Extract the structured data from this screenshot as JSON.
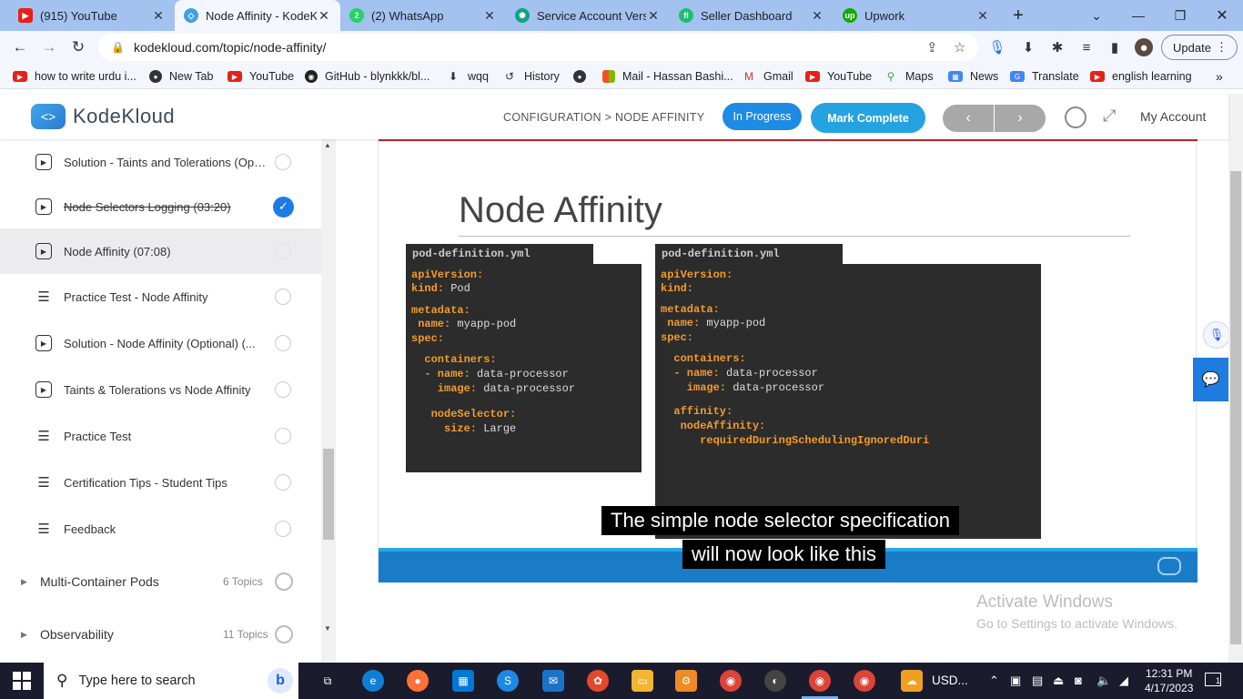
{
  "browser": {
    "tabs": [
      {
        "title": "(915) YouTube",
        "favicon": "youtube-icon"
      },
      {
        "title": "Node Affinity - KodeKloud",
        "favicon": "kodekloud-icon"
      },
      {
        "title": "(2) WhatsApp",
        "favicon": "whatsapp-icon"
      },
      {
        "title": "Service Account Version",
        "favicon": "openai-icon"
      },
      {
        "title": "Seller Dashboard",
        "favicon": "fiverr-icon"
      },
      {
        "title": "Upwork",
        "favicon": "upwork-icon"
      }
    ],
    "url": "kodekloud.com/topic/node-affinity/",
    "update_label": "Update",
    "bookmarks": [
      {
        "label": "how to write urdu i...",
        "icon": "youtube-icon"
      },
      {
        "label": "New Tab",
        "icon": "globe-icon"
      },
      {
        "label": "YouTube",
        "icon": "youtube-icon"
      },
      {
        "label": "GitHub - blynkkk/bl...",
        "icon": "github-icon"
      },
      {
        "label": "wqq",
        "icon": "download-icon"
      },
      {
        "label": "History",
        "icon": "history-icon"
      },
      {
        "label": "",
        "icon": "globe-icon"
      },
      {
        "label": "Mail - Hassan Bashi...",
        "icon": "microsoft-icon"
      },
      {
        "label": "Gmail",
        "icon": "gmail-icon"
      },
      {
        "label": "YouTube",
        "icon": "youtube-icon"
      },
      {
        "label": "Maps",
        "icon": "maps-icon"
      },
      {
        "label": "News",
        "icon": "news-icon"
      },
      {
        "label": "Translate",
        "icon": "translate-icon"
      },
      {
        "label": "english learning",
        "icon": "youtube-icon"
      }
    ]
  },
  "header": {
    "logo_text": "KodeKloud",
    "breadcrumb": "CONFIGURATION > NODE AFFINITY",
    "status_label": "In Progress",
    "mark_complete_label": "Mark Complete",
    "prev_label": "‹",
    "next_label": "›",
    "account_label": "My Account"
  },
  "sidebar": {
    "items": [
      {
        "label": "Solution - Taints and Tolerations (Optional)",
        "type": "video",
        "done": false,
        "current": false
      },
      {
        "label": "Node Selectors Logging (03:20)",
        "type": "video",
        "done": true,
        "current": false
      },
      {
        "label": "Node Affinity (07:08)",
        "type": "video",
        "done": false,
        "current": true
      },
      {
        "label": "Practice Test - Node Affinity",
        "type": "text",
        "done": false,
        "current": false
      },
      {
        "label": "Solution - Node Affinity (Optional) (...",
        "type": "video",
        "done": false,
        "current": false
      },
      {
        "label": "Taints & Tolerations vs Node Affinity",
        "type": "video",
        "done": false,
        "current": false
      },
      {
        "label": "Practice Test",
        "type": "text",
        "done": false,
        "current": false
      },
      {
        "label": "Certification Tips - Student Tips",
        "type": "text",
        "done": false,
        "current": false
      },
      {
        "label": "Feedback",
        "type": "text",
        "done": false,
        "current": false
      }
    ],
    "sections": [
      {
        "label": "Multi-Container Pods",
        "count": "6 Topics"
      },
      {
        "label": "Observability",
        "count": "11 Topics"
      }
    ]
  },
  "video": {
    "slide_title": "Node Affinity",
    "left_tab": "pod-definition.yml",
    "right_tab": "pod-definition.yml",
    "left_code": [
      {
        "k": "apiVersion:",
        "v": ""
      },
      {
        "k": "kind:",
        "v": " Pod"
      },
      {
        "k": "metadata:",
        "v": ""
      },
      {
        "k": " name:",
        "v": " myapp-pod"
      },
      {
        "k": "spec:",
        "v": ""
      },
      {
        "k": "  containers:",
        "v": ""
      },
      {
        "k": "  - name:",
        "v": " data-processor"
      },
      {
        "k": "    image:",
        "v": " data-processor"
      },
      {
        "k": "   nodeSelector:",
        "v": ""
      },
      {
        "k": "     size:",
        "v": " Large"
      }
    ],
    "right_code": [
      {
        "k": "apiVersion:",
        "v": ""
      },
      {
        "k": "kind:",
        "v": ""
      },
      {
        "k": "metadata:",
        "v": ""
      },
      {
        "k": " name:",
        "v": " myapp-pod"
      },
      {
        "k": "spec:",
        "v": ""
      },
      {
        "k": "  containers:",
        "v": ""
      },
      {
        "k": "  - name:",
        "v": " data-processor"
      },
      {
        "k": "    image:",
        "v": " data-processor"
      },
      {
        "k": "  affinity:",
        "v": ""
      },
      {
        "k": "   nodeAffinity:",
        "v": ""
      },
      {
        "k": "      requiredDuringSchedulingIgnoredDuri",
        "v": ""
      }
    ],
    "subtitle_line1": "The simple node selector specification",
    "subtitle_line2": "will now look like this"
  },
  "watermark": {
    "line1": "Activate Windows",
    "line2": "Go to Settings to activate Windows."
  },
  "taskbar": {
    "search_placeholder": "Type here to search",
    "weather": "USD...",
    "time": "12:31 PM",
    "date": "4/17/2023",
    "notifications": "1"
  }
}
